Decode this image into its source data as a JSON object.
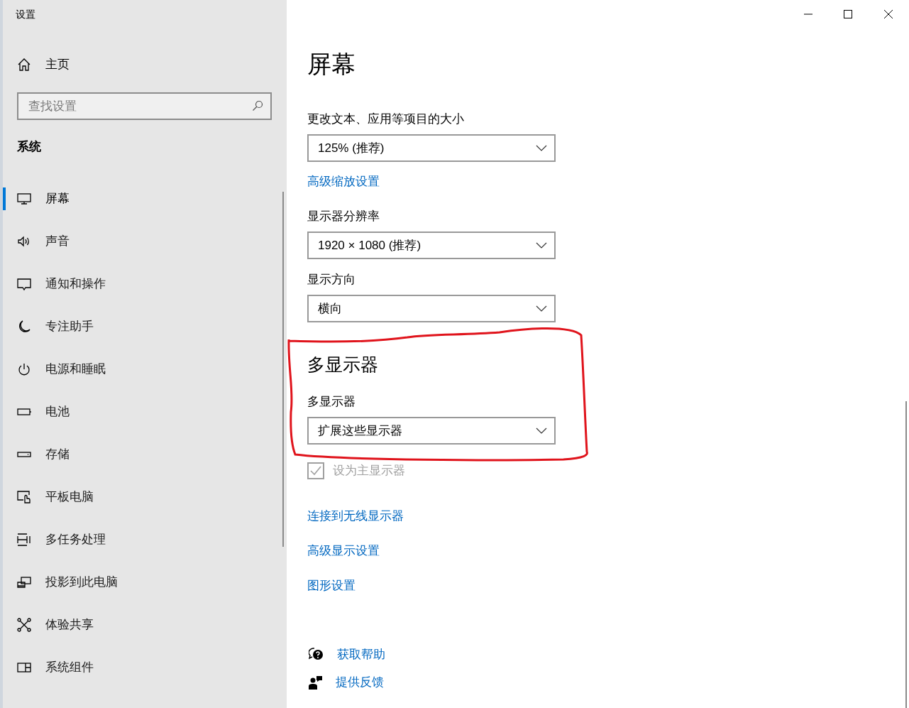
{
  "window": {
    "title": "设置"
  },
  "sidebar": {
    "home": "主页",
    "search": {
      "placeholder": "查找设置"
    },
    "section": "系统",
    "items": [
      {
        "label": "屏幕",
        "selected": true
      },
      {
        "label": "声音",
        "selected": false
      },
      {
        "label": "通知和操作",
        "selected": false
      },
      {
        "label": "专注助手",
        "selected": false
      },
      {
        "label": "电源和睡眠",
        "selected": false
      },
      {
        "label": "电池",
        "selected": false
      },
      {
        "label": "存储",
        "selected": false
      },
      {
        "label": "平板电脑",
        "selected": false
      },
      {
        "label": "多任务处理",
        "selected": false
      },
      {
        "label": "投影到此电脑",
        "selected": false
      },
      {
        "label": "体验共享",
        "selected": false
      },
      {
        "label": "系统组件",
        "selected": false
      }
    ]
  },
  "main": {
    "title": "屏幕",
    "items": [
      {
        "kind": "label",
        "text": "更改文本、应用等项目的大小"
      },
      {
        "kind": "dropdown",
        "value": "125% (推荐)"
      },
      {
        "kind": "link",
        "text": "高级缩放设置"
      },
      {
        "kind": "label",
        "text": "显示器分辨率"
      },
      {
        "kind": "dropdown",
        "value": "1920 × 1080 (推荐)"
      },
      {
        "kind": "label",
        "text": "显示方向"
      },
      {
        "kind": "dropdown",
        "value": "横向"
      },
      {
        "kind": "heading",
        "text": "多显示器"
      },
      {
        "kind": "label",
        "text": "多显示器"
      },
      {
        "kind": "dropdown",
        "value": "扩展这些显示器"
      },
      {
        "kind": "checkbox",
        "text": "设为主显示器",
        "checked": true,
        "disabled": true
      },
      {
        "kind": "link",
        "text": "连接到无线显示器"
      },
      {
        "kind": "link",
        "text": "高级显示设置"
      },
      {
        "kind": "link",
        "text": "图形设置"
      }
    ],
    "help": [
      {
        "kind": "help",
        "text": "获取帮助"
      },
      {
        "kind": "feedback",
        "text": "提供反馈"
      }
    ]
  }
}
